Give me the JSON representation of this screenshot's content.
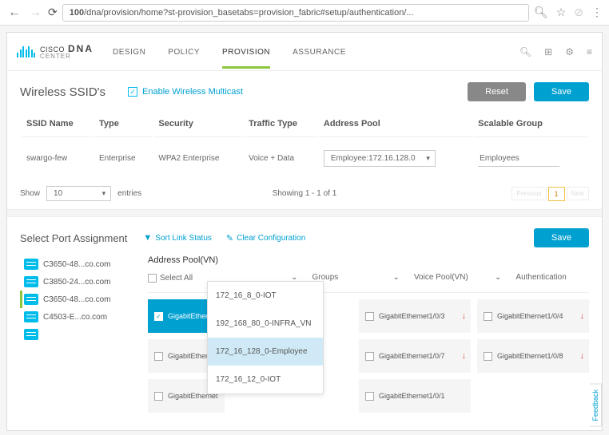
{
  "url": {
    "prefix": "100",
    "path": "/dna/provision/home?st-provision_basetabs=provision_fabric#setup/authentication/..."
  },
  "brand": {
    "cisco": "CISCO",
    "dna": "DNA",
    "center": "CENTER"
  },
  "nav": {
    "design": "DESIGN",
    "policy": "POLICY",
    "provision": "PROVISION",
    "assurance": "ASSURANCE"
  },
  "ssid": {
    "title": "Wireless SSID's",
    "multicast": "Enable Wireless Multicast",
    "reset": "Reset",
    "save": "Save",
    "cols": {
      "name": "SSID Name",
      "type": "Type",
      "security": "Security",
      "traffic": "Traffic Type",
      "pool": "Address Pool",
      "sg": "Scalable Group"
    },
    "row": {
      "name": "swargo-few",
      "type": "Enterprise",
      "security": "WPA2 Enterprise",
      "traffic": "Voice + Data",
      "pool": "Employee:172.16.128.0",
      "sg": "Employees"
    },
    "show": "Show",
    "show_n": "10",
    "entries": "entries",
    "showing": "Showing 1 - 1 of 1",
    "prev": "Previous",
    "page": "1",
    "next": "Next"
  },
  "ports": {
    "title": "Select Port Assignment",
    "sort": "Sort Link Status",
    "clear": "Clear Configuration",
    "save": "Save",
    "switches": [
      "C3650-48...co.com",
      "C3850-24...co.com",
      "C3650-48...co.com",
      "C4503-E...co.com"
    ],
    "select_all": "Select All",
    "cols": {
      "pool": "Address Pool(VN)",
      "groups": "Groups",
      "voice": "Voice Pool(VN)",
      "auth": "Authentication"
    },
    "dd": [
      "172_16_8_0-IOT",
      "192_168_80_0-INFRA_VN",
      "172_16_128_0-Employee",
      "172_16_12_0-IOT"
    ],
    "row1": [
      "GigabitEthernet",
      "GigabitEthernet1/0/3",
      "GigabitEthernet1/0/4"
    ],
    "row2": [
      "GigabitEthernet",
      "GigabitEthernet1/0/7",
      "GigabitEthernet1/0/8"
    ],
    "row3": [
      "GigabitEthernet",
      "GigabitEthernet1/0/1"
    ]
  },
  "feedback": "Feedback"
}
